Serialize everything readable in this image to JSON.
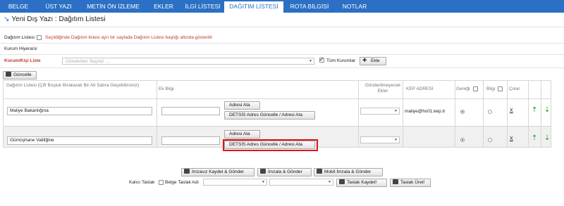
{
  "tabs": [
    {
      "label": "BELGE"
    },
    {
      "label": "ÜST YAZI"
    },
    {
      "label": "METİN ÖN İZLEME"
    },
    {
      "label": "EKLER"
    },
    {
      "label": "İLGİ LİSTESİ"
    },
    {
      "label": "DAĞITIM LİSTESİ"
    },
    {
      "label": "ROTA BİLGİSİ"
    },
    {
      "label": "NOTLAR"
    }
  ],
  "title": "Yeni Dış Yazı : Dağıtım Listesi",
  "distribution_option": {
    "label": "Dağıtım Listesi",
    "note": "Seçildiğinde Dağıtım listesi ayrı bir sayfada Dağıtım Listesi başlığı altında gösterilir"
  },
  "hierarchy_label": "Kurum Hiyerarsi",
  "recipient": {
    "label": "Kurum/Kişi Liste",
    "placeholder": "Gönderilen Seçiniz ...",
    "all_label": "Tüm Kurumlar",
    "add_label": "Ekle"
  },
  "update_label": "Güncelle",
  "columns": {
    "list": "Dağıtım Listesi (Çift Boşluk Bırakarak Bir Alt Satıra Geçebilirsiniz)",
    "ek": "Ek Bilgi",
    "notsent": "Gönderilmeyecek Ekler",
    "kep": "KEP ADRESİ",
    "gereg": "Gereği",
    "bilgi": "Bilgi",
    "cikar": "Çıkar"
  },
  "rows": [
    {
      "name": "Maliye Bakanlığına",
      "kep": "maliye@hs01.kep.tr",
      "assign": "Adresi Ata",
      "update": "DETSİS Adres Güncelle / Adresi Ata",
      "remove": "X"
    },
    {
      "name": "Gümüşhane Valiliğine",
      "kep": "",
      "assign": "Adresi Ata",
      "update": "DETSİS Adres Güncelle / Adresi Ata",
      "remove": "X"
    }
  ],
  "actions": {
    "sign_unsigned": "İmzasız Kaydet & Gönder",
    "sign_send": "İmzala & Gönder",
    "mobile_sign": "Mobil İmzala & Gönder"
  },
  "draft": {
    "permanent": "Kalıcı Taslak",
    "name_label": "Belge Taslak Adı",
    "save": "Taslak Kaydet!",
    "generate": "Taslak Üret!"
  },
  "colors": {
    "tab_bar": "#2b70c4",
    "highlight": "#e0131a",
    "arrow": "#39a939"
  }
}
